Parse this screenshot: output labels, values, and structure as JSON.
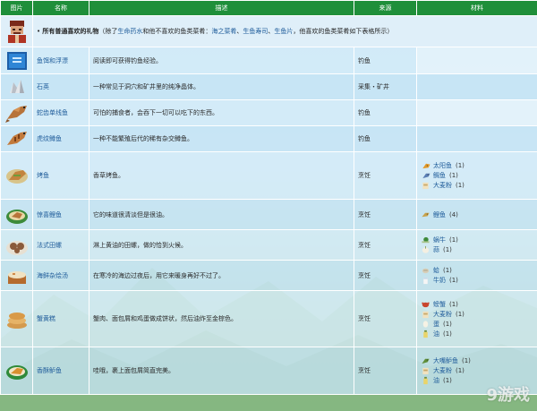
{
  "headers": {
    "image": "图片",
    "name": "名称",
    "desc": "描述",
    "source": "来源",
    "materials": "材料"
  },
  "gift_row": {
    "bullet": "•",
    "bold": "所有普通喜欢的礼物",
    "open": "（除了",
    "ex1": "生命药水",
    "mid1": "和他不喜欢的鱼类菜肴：",
    "ex2": "海之菜肴",
    "sep1": "、",
    "ex3": "生鱼寿司",
    "sep2": "、",
    "ex4": "生鱼片",
    "tail": "，他喜欢的鱼类菜肴如下表格所示）"
  },
  "rows": [
    {
      "name": "鱼饵和浮漂",
      "desc": "阅读即可获得钓鱼经验。",
      "source": "钓鱼",
      "icon": "book-icon",
      "materials": []
    },
    {
      "name": "石英",
      "desc": "一种常见于洞穴和矿井里的纯净晶体。",
      "source": "采集・矿井",
      "icon": "quartz-icon",
      "materials": []
    },
    {
      "name": "蛇齿单线鱼",
      "desc": "可怕的捕食者，会吞下一切可以吃下的东西。",
      "source": "钓鱼",
      "icon": "lingcod-icon",
      "materials": []
    },
    {
      "name": "虎纹鳟鱼",
      "desc": "一种不能繁殖后代的稀有杂交鳟鱼。",
      "source": "钓鱼",
      "icon": "tiger-trout-icon",
      "materials": []
    },
    {
      "name": "烤鱼",
      "desc": "香草烤鱼。",
      "source": "烹饪",
      "icon": "baked-fish-icon",
      "materials": [
        {
          "name": "太阳鱼",
          "qty": "(1)",
          "icon": "sunfish-icon"
        },
        {
          "name": "鲷鱼",
          "qty": "(1)",
          "icon": "bream-icon"
        },
        {
          "name": "大麦粉",
          "qty": "(1)",
          "icon": "wheat-flour-icon"
        }
      ]
    },
    {
      "name": "惊喜鲤鱼",
      "desc": "它的味道很清淡但是很油。",
      "source": "烹饪",
      "icon": "carp-surprise-icon",
      "materials": [
        {
          "name": "鲤鱼",
          "qty": "(4)",
          "icon": "carp-icon"
        }
      ]
    },
    {
      "name": "法式田螺",
      "desc": "淋上黄油的田螺，做的恰到火候。",
      "source": "烹饪",
      "icon": "escargot-icon",
      "materials": [
        {
          "name": "蜗牛",
          "qty": "(1)",
          "icon": "snail-icon"
        },
        {
          "name": "蒜",
          "qty": "(1)",
          "icon": "garlic-icon"
        }
      ]
    },
    {
      "name": "海鲜杂烩汤",
      "desc": "在寒冷的海边过夜后，用它来暖身再好不过了。",
      "source": "烹饪",
      "icon": "chowder-icon",
      "materials": [
        {
          "name": "蛤",
          "qty": "(1)",
          "icon": "clam-icon"
        },
        {
          "name": "牛奶",
          "qty": "(1)",
          "icon": "milk-icon"
        }
      ]
    },
    {
      "name": "蟹黄糕",
      "desc": "蟹肉、面包屑和鸡蛋做成饼状，然后油炸至金棕色。",
      "source": "烹饪",
      "icon": "crab-cakes-icon",
      "materials": [
        {
          "name": "螃蟹",
          "qty": "(1)",
          "icon": "crab-icon"
        },
        {
          "name": "大麦粉",
          "qty": "(1)",
          "icon": "wheat-flour-icon"
        },
        {
          "name": "蛋",
          "qty": "(1)",
          "icon": "egg-icon"
        },
        {
          "name": "油",
          "qty": "(1)",
          "icon": "oil-icon"
        }
      ]
    },
    {
      "name": "香酥鲈鱼",
      "desc": "哇哦，裹上面包屑简直完美。",
      "source": "烹饪",
      "icon": "crispy-bass-icon",
      "materials": [
        {
          "name": "大嘴鲈鱼",
          "qty": "(1)",
          "icon": "largemouth-bass-icon"
        },
        {
          "name": "大麦粉",
          "qty": "(1)",
          "icon": "wheat-flour-icon"
        },
        {
          "name": "油",
          "qty": "(1)",
          "icon": "oil-icon"
        }
      ]
    }
  ]
}
